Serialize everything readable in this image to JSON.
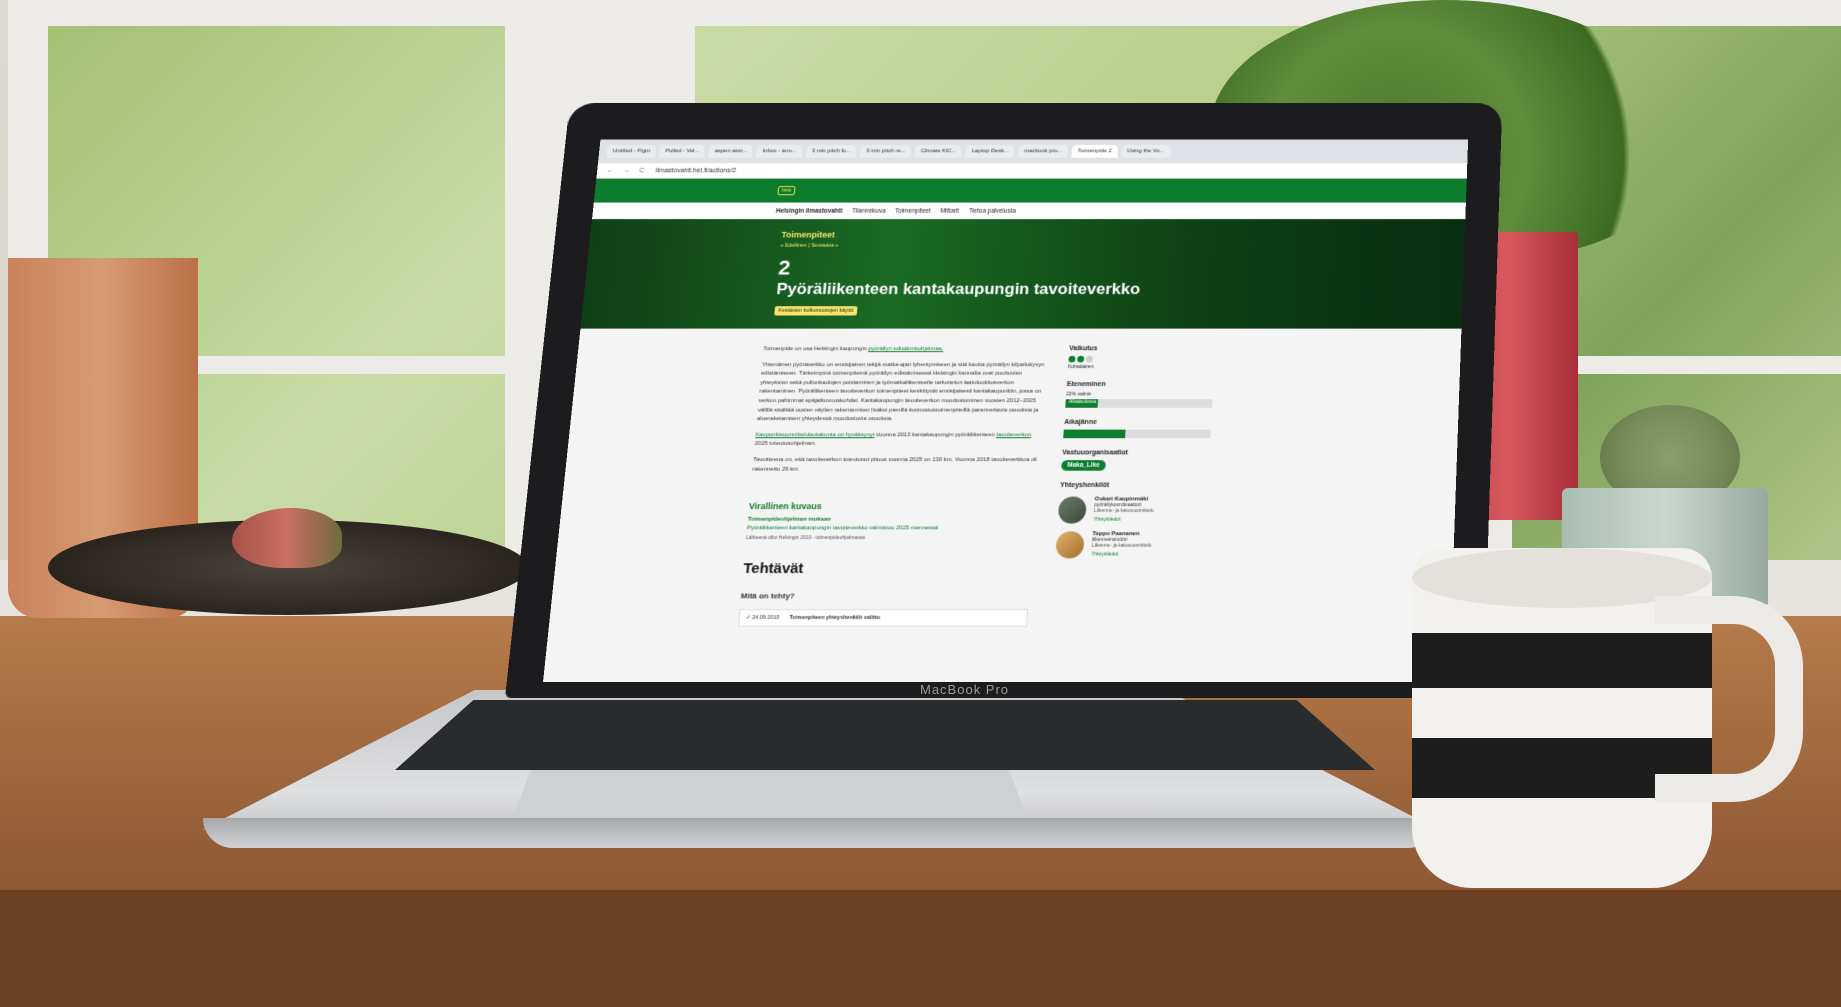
{
  "browser": {
    "tabs": [
      {
        "label": "Untitled - Figm"
      },
      {
        "label": "Pulled - Vel..."
      },
      {
        "label": "aspen assr..."
      },
      {
        "label": "Inbox - tero..."
      },
      {
        "label": "3 min pitch fo..."
      },
      {
        "label": "3 min pitch re..."
      },
      {
        "label": "Climate KIC..."
      },
      {
        "label": "Laptop Desk..."
      },
      {
        "label": "macbook pro..."
      },
      {
        "label": "Toimenpide 2"
      },
      {
        "label": "Using the Vo..."
      }
    ],
    "active_tab_index": 9,
    "url": "ilmastovahti.hel.fi/actions/2",
    "nav_glyphs": "← → C"
  },
  "site": {
    "badge": "beta",
    "brand": "Helsingin ilmastovahti",
    "nav": [
      "Tilannekuva",
      "Toimenpiteet",
      "Mittarit",
      "Tietoa palvelusta"
    ]
  },
  "hero": {
    "section": "Toimenpiteet",
    "crumbs": "« Edellinen | Seuraava »",
    "number": "2",
    "title": "Pyöräliikenteen kantakaupungin tavoiteverkko",
    "tag": "Kestävien kulkumuotojen käyttö"
  },
  "main": {
    "intro_prefix": "Toimenpide on osa Helsingin kaupungin ",
    "intro_link": "pyöräilyn edistämisohjelmaa.",
    "para1": "Yhtenäinen pyöräverkko on ensisijainen tekijä matka-ajan lyhentymiseen ja sitä kautta pyöräilyn kilpailukyvyn edistämiseen. Tärkeimpinä toimenpiteinä pyöräilyn edistämisessä Helsingin kannalta ovat puuttuvien yhteyksien sekä pullonkaulojen poistaminen ja työmatkaliikenteelle tarkoitetun laatuluokitusverkon rakentaminen. Pyöräliikenteen tavoiteverkon toimenpiteet keskittyvät ensisijaisesti kantakaupunkiin, jossa on verkon pahimmat epäjatkuvuuskohdat. Kantakaupungin tavoiteverkon muodostuminen vuosien 2012–2025 välillä sisältää uusien väylien rakentamisen lisäksi pienillä kunnostustoimenpiteillä parannettavia osuuksia ja alueraketamisen yhteydessä muodostuvia osuuksia.",
    "para2_link": "Kaupunkisuunnittelulautakunta on hyväksynyt",
    "para2_mid": " vuonna 2013 kantakaupungin pyöräliikenteen ",
    "para2_link2": "tavoiteverkon",
    "para2_end": " 2025 toteutusohjelman.",
    "para3": "Tavoitteena on, että tavoiteverkon toteutunut pituus vuonna 2025 on 130 km. Vuonna 2018 tavoiteverkkoa oli rakennettu 29 km.",
    "official_heading": "Virallinen kuvaus",
    "official_sub": "Toimenpideohjelman mukaan",
    "official_text": "Pyöräliikenteen kantakaupungin tavoiteverkko valmistuu 2025 mennessä",
    "official_source": "Lähteenä ollut Helsingin 2019 - toimenpideohjelmassa",
    "tasks_heading": "Tehtävät",
    "tasks_sub": "Mitä on tehty?",
    "task_date": "✓ 24.09.2019",
    "task_text": "Toimenpiteen yhteyshenkilö valittu"
  },
  "side": {
    "impact_label": "Vaikutus",
    "impact_value": "Kohtalainen",
    "impact_level": 2,
    "impact_max": 3,
    "progress_label": "Eteneminen",
    "progress_text": "22% valmis",
    "progress_status": "Aikataulussa",
    "progress_fraction": 0.22,
    "schedule_label": "Aikajänne",
    "schedule_fraction": 0.42,
    "orgs_label": "Vastuuorganisaatiot",
    "org": "Maka_Like",
    "contacts_label": "Yhteyshenkilöt",
    "contacts": [
      {
        "name": "Oskari Kaupinmäki",
        "role": "pyöräilykoordinaattori",
        "dept": "Liikenne- ja katusuunnittelu",
        "more": "Yhteystiedot"
      },
      {
        "name": "Teppo Paananen",
        "role": "liikenneinsinööri",
        "dept": "Liikenne- ja katusuunnittelu",
        "more": "Yhteystiedot"
      }
    ]
  },
  "laptop": {
    "model": "MacBook Pro"
  }
}
